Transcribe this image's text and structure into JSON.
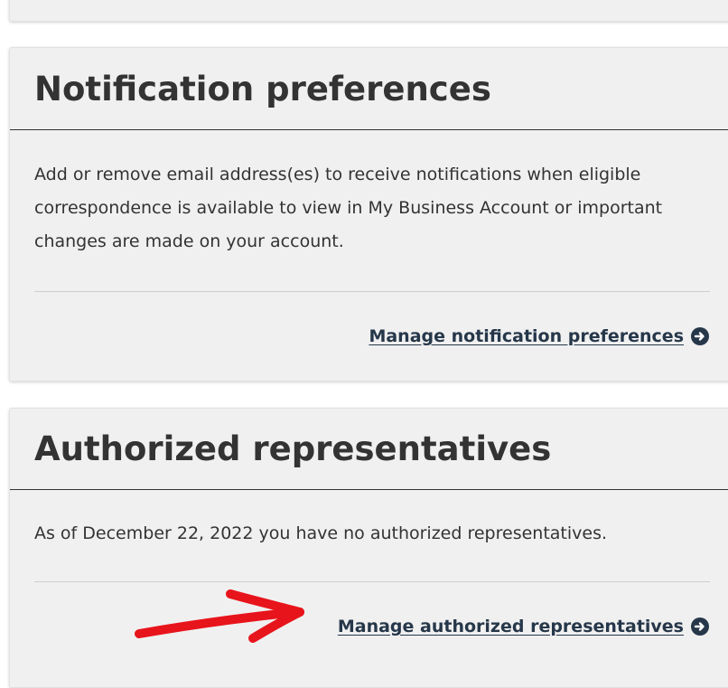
{
  "notification_section": {
    "title": "Notification preferences",
    "description": "Add or remove email address(es) to receive notifications when eligible correspondence is available to view in My Business Account or important changes are made on your account.",
    "link_label": "Manage notification preferences",
    "link_icon": "circle-arrow-right-icon"
  },
  "authorized_section": {
    "title": "Authorized representatives",
    "description": "As of December 22, 2022 you have no authorized representatives.",
    "link_label": "Manage authorized representatives",
    "link_icon": "circle-arrow-right-icon"
  },
  "annotation": {
    "type": "red-hand-drawn-arrow",
    "color": "#e8141b"
  },
  "colors": {
    "panel_bg": "#f0f0f0",
    "link": "#26374a",
    "text": "#333333"
  }
}
